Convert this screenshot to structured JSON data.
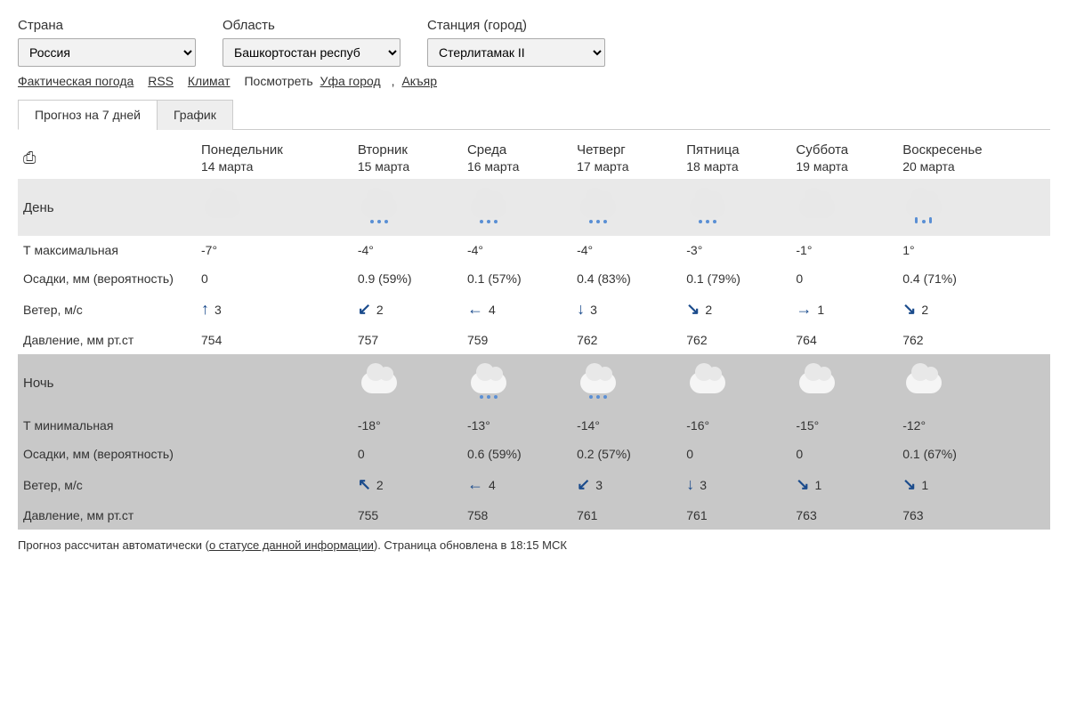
{
  "selectors": {
    "country": {
      "label": "Страна",
      "value": "Россия"
    },
    "region": {
      "label": "Область",
      "value": "Башкортостан респуб"
    },
    "station": {
      "label": "Станция (город)",
      "value": "Стерлитамак II"
    }
  },
  "links": {
    "actual_weather": "Фактическая погода",
    "rss": "RSS",
    "climate": "Климат",
    "see_label": "Посмотреть",
    "city1": "Уфа город",
    "city2": "Акъяр"
  },
  "tabs": {
    "forecast7": "Прогноз на 7 дней",
    "chart": "График"
  },
  "row_labels": {
    "day": "День",
    "tmax": "Т максимальная",
    "precip": "Осадки, мм (вероятность)",
    "wind": "Ветер, м/с",
    "pressure": "Давление, мм рт.ст",
    "night": "Ночь",
    "tmin": "Т минимальная"
  },
  "days": [
    {
      "dow": "Понедельник",
      "date": "14 марта",
      "day_icon": "cloudy",
      "tmax": "-7°",
      "precip_d": "0",
      "wind_d_dir": "↑",
      "wind_d_spd": "3",
      "press_d": "754",
      "night_icon": "",
      "tmin": "",
      "precip_n": "",
      "wind_n_dir": "",
      "wind_n_spd": "",
      "press_n": ""
    },
    {
      "dow": "Вторник",
      "date": "15 марта",
      "day_icon": "snow",
      "tmax": "-4°",
      "precip_d": "0.9 (59%)",
      "wind_d_dir": "↙",
      "wind_d_spd": "2",
      "press_d": "757",
      "night_icon": "cloudy",
      "tmin": "-18°",
      "precip_n": "0",
      "wind_n_dir": "↖",
      "wind_n_spd": "2",
      "press_n": "755"
    },
    {
      "dow": "Среда",
      "date": "16 марта",
      "day_icon": "snow",
      "tmax": "-4°",
      "precip_d": "0.1 (57%)",
      "wind_d_dir": "←",
      "wind_d_spd": "4",
      "press_d": "759",
      "night_icon": "snow",
      "tmin": "-13°",
      "precip_n": "0.6 (59%)",
      "wind_n_dir": "←",
      "wind_n_spd": "4",
      "press_n": "758"
    },
    {
      "dow": "Четверг",
      "date": "17 марта",
      "day_icon": "snow",
      "tmax": "-4°",
      "precip_d": "0.4 (83%)",
      "wind_d_dir": "↓",
      "wind_d_spd": "3",
      "press_d": "762",
      "night_icon": "snow",
      "tmin": "-14°",
      "precip_n": "0.2 (57%)",
      "wind_n_dir": "↙",
      "wind_n_spd": "3",
      "press_n": "761"
    },
    {
      "dow": "Пятница",
      "date": "18 марта",
      "day_icon": "snow",
      "tmax": "-3°",
      "precip_d": "0.1 (79%)",
      "wind_d_dir": "↘",
      "wind_d_spd": "2",
      "press_d": "762",
      "night_icon": "cloudy",
      "tmin": "-16°",
      "precip_n": "0",
      "wind_n_dir": "↓",
      "wind_n_spd": "3",
      "press_n": "761"
    },
    {
      "dow": "Суббота",
      "date": "19 марта",
      "day_icon": "partly-sunny",
      "tmax": "-1°",
      "precip_d": "0",
      "wind_d_dir": "→",
      "wind_d_spd": "1",
      "press_d": "764",
      "night_icon": "cloudy",
      "tmin": "-15°",
      "precip_n": "0",
      "wind_n_dir": "↘",
      "wind_n_spd": "1",
      "press_n": "763"
    },
    {
      "dow": "Воскресенье",
      "date": "20 марта",
      "day_icon": "rain-snow",
      "tmax": "1°",
      "precip_d": "0.4 (71%)",
      "wind_d_dir": "↘",
      "wind_d_spd": "2",
      "press_d": "762",
      "night_icon": "partly-cloudy-night",
      "tmin": "-12°",
      "precip_n": "0.1 (67%)",
      "wind_n_dir": "↘",
      "wind_n_spd": "1",
      "press_n": "763"
    }
  ],
  "footer": {
    "text_before": "Прогноз рассчитан автоматически (",
    "link": "о статусе данной информации",
    "text_after": "). Страница обновлена в 18:15 МСК"
  }
}
